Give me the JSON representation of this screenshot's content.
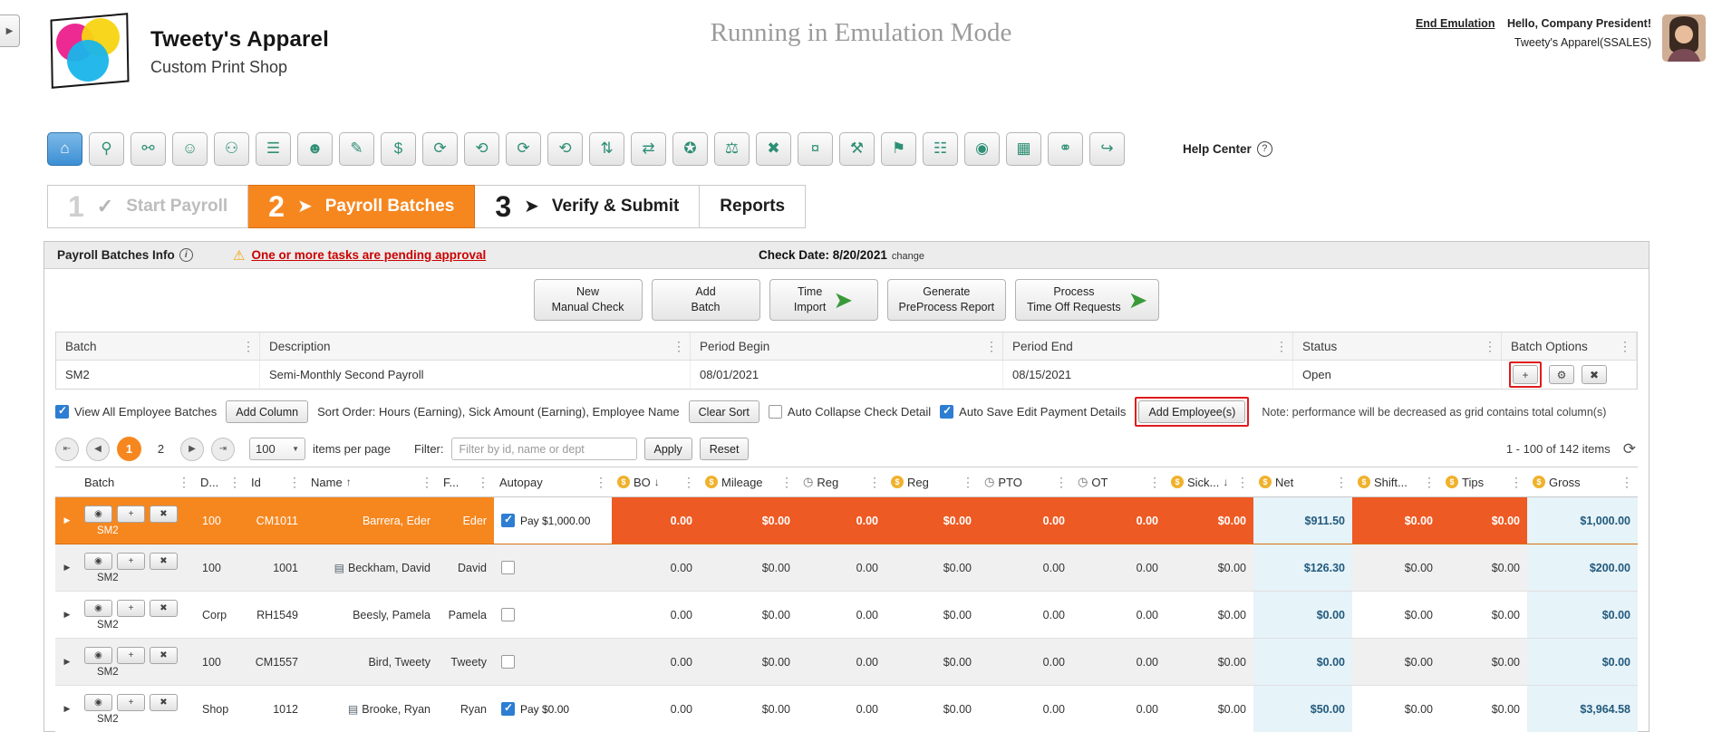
{
  "colors": {
    "orange": "#f6871f",
    "hot": "#ee5a23",
    "blue-cell": "#e6f3f9",
    "blue-cell-text": "#235a7c",
    "red": "#e01c1c",
    "green": "#3a9a3a",
    "icon-teal": "#2e8f75",
    "blue-check": "#2d7dd2",
    "coin": "#f0b12b"
  },
  "icons": {
    "kebab": "⋮",
    "sort_up": "↑",
    "sort_down": "↓",
    "dollar": "$",
    "clock": "◷",
    "expand": "▶",
    "eye": "◉",
    "plus": "+",
    "remove": "✖",
    "gear": "⚙",
    "doc": "▤",
    "warning": "⚠",
    "info": "i",
    "help": "?",
    "refresh": "⟳",
    "page_first": "⇤",
    "page_prev": "◀",
    "page_next": "▶",
    "page_last": "⇥",
    "caret_down": "▼",
    "check": "✓",
    "arrow": "➤",
    "panel_toggle": "▶"
  },
  "header": {
    "logo_title": "Tweety's Apparel",
    "logo_subtitle": "Custom Print Shop",
    "emulation_banner": "Running in Emulation Mode",
    "end_emulation": "End Emulation",
    "greeting": "Hello, Company President!",
    "account": "Tweety's Apparel(SSALES)"
  },
  "toolbar": {
    "help_label": "Help Center",
    "icons": [
      {
        "name": "home",
        "glyph": "⌂",
        "active": true
      },
      {
        "name": "employee-search",
        "glyph": "⚲"
      },
      {
        "name": "org-chart",
        "glyph": "⚯"
      },
      {
        "name": "new-hire",
        "glyph": "☺"
      },
      {
        "name": "employee-groups",
        "glyph": "⚇"
      },
      {
        "name": "team-list",
        "glyph": "☰"
      },
      {
        "name": "employee-profile",
        "glyph": "☻"
      },
      {
        "name": "forms",
        "glyph": "✎"
      },
      {
        "name": "payroll-money",
        "glyph": "$"
      },
      {
        "name": "pay-cycle",
        "glyph": "⟳"
      },
      {
        "name": "pay-schedule",
        "glyph": "⟲"
      },
      {
        "name": "process-payroll",
        "glyph": "⟳"
      },
      {
        "name": "pay-history",
        "glyph": "⟲"
      },
      {
        "name": "time-import",
        "glyph": "⇅"
      },
      {
        "name": "employee-transfer",
        "glyph": "⇄"
      },
      {
        "name": "security-user",
        "glyph": "✪"
      },
      {
        "name": "user-audit",
        "glyph": "⚖"
      },
      {
        "name": "user-remove",
        "glyph": "✖"
      },
      {
        "name": "tax-money",
        "glyph": "¤"
      },
      {
        "name": "contractors",
        "glyph": "⚒"
      },
      {
        "name": "person-flag",
        "glyph": "⚑"
      },
      {
        "name": "roster-grid",
        "glyph": "☷"
      },
      {
        "name": "fingerprint-clock",
        "glyph": "◉"
      },
      {
        "name": "benefits",
        "glyph": "▦"
      },
      {
        "name": "team-pair",
        "glyph": "⚭"
      },
      {
        "name": "logout-user",
        "glyph": "↪"
      }
    ]
  },
  "wizard": {
    "steps": [
      {
        "number": "1",
        "label": "Start Payroll"
      },
      {
        "number": "2",
        "label": "Payroll Batches"
      },
      {
        "number": "3",
        "label": "Verify & Submit"
      },
      {
        "label": "Reports"
      }
    ]
  },
  "panel": {
    "title": "Payroll Batches Info",
    "warning": "One or more tasks are pending approval",
    "check_date_label": "Check Date: 8/20/2021",
    "change_link": "change"
  },
  "action_buttons": [
    {
      "line1": "New",
      "line2": "Manual Check",
      "arrow": false
    },
    {
      "line1": "Add",
      "line2": "Batch",
      "arrow": false
    },
    {
      "line1": "Time",
      "line2": "Import",
      "arrow": true
    },
    {
      "line1": "Generate",
      "line2": "PreProcess Report",
      "arrow": false
    },
    {
      "line1": "Process",
      "line2": "Time Off Requests",
      "arrow": true
    }
  ],
  "batch_grid": {
    "columns": [
      "Batch",
      "Description",
      "Period Begin",
      "Period End",
      "Status",
      "Batch Options"
    ],
    "row": {
      "batch": "SM2",
      "description": "Semi-Monthly Second Payroll",
      "period_begin": "08/01/2021",
      "period_end": "08/15/2021",
      "status": "Open"
    }
  },
  "options_bar": {
    "view_all_label": "View All Employee Batches",
    "view_all_checked": true,
    "add_column_label": "Add Column",
    "sort_order_label": "Sort Order: Hours (Earning), Sick Amount (Earning), Employee Name",
    "clear_sort_label": "Clear Sort",
    "auto_collapse_label": "Auto Collapse Check Detail",
    "auto_collapse_checked": false,
    "auto_save_label": "Auto Save Edit Payment Details",
    "auto_save_checked": true,
    "add_employees_label": "Add Employee(s)",
    "note": "Note: performance will be decreased as grid contains total column(s)"
  },
  "pagination": {
    "pages": [
      "1",
      "2"
    ],
    "page_size": "100",
    "items_per_page_label": "items per page",
    "filter_label": "Filter:",
    "filter_placeholder": "Filter by id, name or dept",
    "filter_value": "",
    "apply_label": "Apply",
    "reset_label": "Reset",
    "range_label": "1 - 100 of 142 items"
  },
  "employee_grid": {
    "columns": [
      {
        "label": "Batch"
      },
      {
        "label": "D..."
      },
      {
        "label": "Id"
      },
      {
        "label": "Name"
      },
      {
        "label": "F..."
      },
      {
        "label": "Autopay"
      },
      {
        "label": "BO"
      },
      {
        "label": "Mileage"
      },
      {
        "label": "Reg"
      },
      {
        "label": "Reg"
      },
      {
        "label": "PTO"
      },
      {
        "label": "OT"
      },
      {
        "label": "Sick..."
      },
      {
        "label": "Net"
      },
      {
        "label": "Shift..."
      },
      {
        "label": "Tips"
      },
      {
        "label": "Gross"
      }
    ],
    "rows": [
      {
        "selected": true,
        "shaded": false,
        "batch": "SM2",
        "dept": "100",
        "id": "CM1011",
        "doc": false,
        "name": "Barrera, Eder",
        "first": "Eder",
        "autopay": true,
        "autopay_label": "Pay $1,000.00",
        "bo": "0.00",
        "mileage": "$0.00",
        "reg_hrs": "0.00",
        "reg_amt": "$0.00",
        "pto": "0.00",
        "ot": "0.00",
        "sick": "$0.00",
        "net": "$911.50",
        "shift": "$0.00",
        "tips": "$0.00",
        "gross": "$1,000.00"
      },
      {
        "selected": false,
        "shaded": true,
        "batch": "SM2",
        "dept": "100",
        "id": "1001",
        "doc": true,
        "name": "Beckham, David",
        "first": "David",
        "autopay": false,
        "autopay_label": "",
        "bo": "0.00",
        "mileage": "$0.00",
        "reg_hrs": "0.00",
        "reg_amt": "$0.00",
        "pto": "0.00",
        "ot": "0.00",
        "sick": "$0.00",
        "net": "$126.30",
        "shift": "$0.00",
        "tips": "$0.00",
        "gross": "$200.00"
      },
      {
        "selected": false,
        "shaded": false,
        "batch": "SM2",
        "dept": "Corp",
        "id": "RH1549",
        "doc": false,
        "name": "Beesly, Pamela",
        "first": "Pamela",
        "autopay": false,
        "autopay_label": "",
        "bo": "0.00",
        "mileage": "$0.00",
        "reg_hrs": "0.00",
        "reg_amt": "$0.00",
        "pto": "0.00",
        "ot": "0.00",
        "sick": "$0.00",
        "net": "$0.00",
        "shift": "$0.00",
        "tips": "$0.00",
        "gross": "$0.00"
      },
      {
        "selected": false,
        "shaded": true,
        "batch": "SM2",
        "dept": "100",
        "id": "CM1557",
        "doc": false,
        "name": "Bird, Tweety",
        "first": "Tweety",
        "autopay": false,
        "autopay_label": "",
        "bo": "0.00",
        "mileage": "$0.00",
        "reg_hrs": "0.00",
        "reg_amt": "$0.00",
        "pto": "0.00",
        "ot": "0.00",
        "sick": "$0.00",
        "net": "$0.00",
        "shift": "$0.00",
        "tips": "$0.00",
        "gross": "$0.00"
      },
      {
        "selected": false,
        "shaded": false,
        "batch": "SM2",
        "dept": "Shop",
        "id": "1012",
        "doc": true,
        "name": "Brooke, Ryan",
        "first": "Ryan",
        "autopay": true,
        "autopay_label": "Pay $0.00",
        "bo": "0.00",
        "mileage": "$0.00",
        "reg_hrs": "0.00",
        "reg_amt": "$0.00",
        "pto": "0.00",
        "ot": "0.00",
        "sick": "$0.00",
        "net": "$50.00",
        "shift": "$0.00",
        "tips": "$0.00",
        "gross": "$3,964.58"
      }
    ]
  }
}
